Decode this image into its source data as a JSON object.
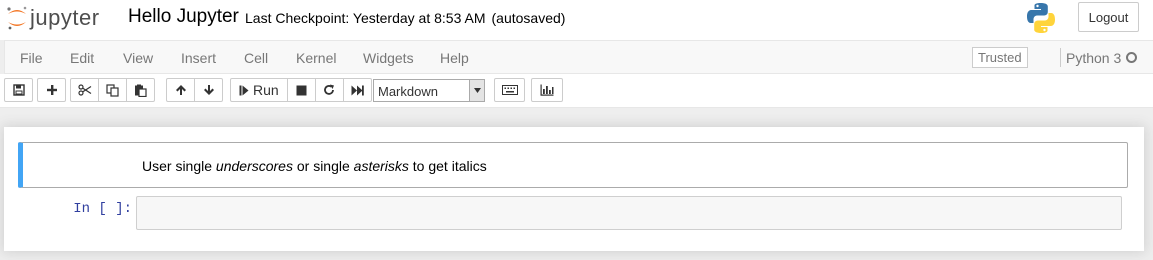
{
  "header": {
    "logo_text": "jupyter",
    "notebook_title": "Hello Jupyter",
    "checkpoint_text": "Last Checkpoint: Yesterday at 8:53 AM",
    "autosave_text": "(autosaved)",
    "logout_label": "Logout"
  },
  "menubar": {
    "items": [
      "File",
      "Edit",
      "View",
      "Insert",
      "Cell",
      "Kernel",
      "Widgets",
      "Help"
    ],
    "trusted_label": "Trusted",
    "kernel_name": "Python 3"
  },
  "toolbar": {
    "run_label": "Run",
    "cell_type_selected": "Markdown",
    "icons": [
      "save-icon",
      "plus-icon",
      "cut-icon",
      "copy-icon",
      "paste-icon",
      "arrow-up-icon",
      "arrow-down-icon",
      "step-forward-icon",
      "stop-icon",
      "restart-icon",
      "fast-forward-icon",
      "keyboard-icon",
      "bar-chart-icon"
    ]
  },
  "cells": {
    "markdown": {
      "parts": [
        {
          "text": "User single ",
          "italic": false
        },
        {
          "text": "underscores",
          "italic": true
        },
        {
          "text": " or single ",
          "italic": false
        },
        {
          "text": "asterisks",
          "italic": true
        },
        {
          "text": " to get italics",
          "italic": false
        }
      ]
    },
    "code": {
      "prompt": "In [ ]:",
      "source": ""
    }
  },
  "colors": {
    "logo_orange": "#f37726",
    "selected_cell_border": "#42a5f5",
    "prompt_blue": "#303f9f",
    "python_blue": "#3776ab",
    "python_yellow": "#ffd43b"
  }
}
